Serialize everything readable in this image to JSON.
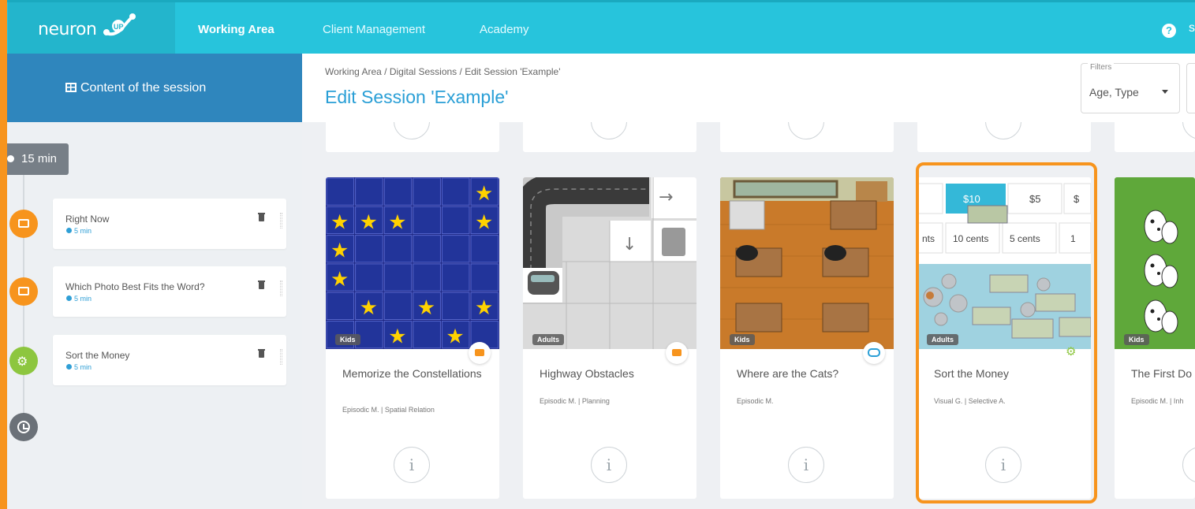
{
  "app": {
    "logo_text": "neuron",
    "logo_badge": "UP",
    "nav": [
      "Working Area",
      "Client Management",
      "Academy"
    ],
    "help_label": "?",
    "cut_label": "s"
  },
  "sidebar": {
    "header_label": "Content of the session",
    "total_duration": "15 min",
    "items": [
      {
        "name": "Right Now",
        "duration": "5 min",
        "type": "card",
        "color": "#f7941d"
      },
      {
        "name": "Which Photo Best Fits the Word?",
        "duration": "5 min",
        "type": "card",
        "color": "#f7941d"
      },
      {
        "name": "Sort the Money",
        "duration": "5 min",
        "type": "gears",
        "color": "#8dc63f"
      }
    ]
  },
  "main": {
    "breadcrumb": "Working Area  /  Digital Sessions  /  Edit Session 'Example'",
    "title": "Edit Session 'Example'",
    "filters": {
      "label": "Filters",
      "value": "Age, Type"
    }
  },
  "cards": [
    {
      "title": "Memorize the Constellations",
      "tags": "Episodic M. | Spatial Relation",
      "age": "Kids",
      "type": "card-icon"
    },
    {
      "title": "Highway Obstacles",
      "tags": "Episodic M. | Planning",
      "age": "Adults",
      "type": "card-icon"
    },
    {
      "title": "Where are the Cats?",
      "tags": "Episodic M.",
      "age": "Kids",
      "type": "gamepad-icon"
    },
    {
      "title": "Sort the Money",
      "tags": "Visual G. | Selective A.",
      "age": "Adults",
      "type": "gears-icon",
      "money": {
        "row1": [
          "$10",
          "$5",
          "$"
        ],
        "row2": [
          "nts",
          "10 cents",
          "5 cents",
          "1"
        ]
      }
    },
    {
      "title": "The First Do",
      "tags": "Episodic M. | Inh",
      "age": "Kids",
      "type": "card-icon"
    }
  ],
  "info_glyph": "i"
}
